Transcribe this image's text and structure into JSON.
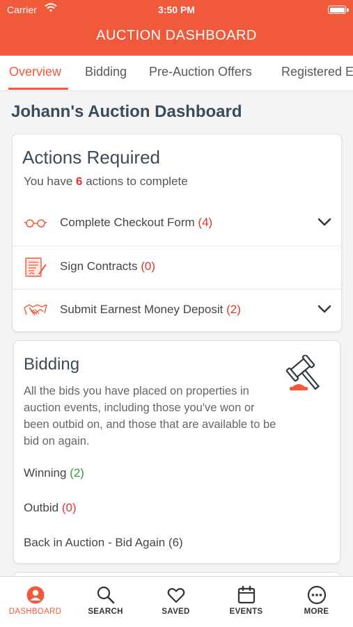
{
  "status": {
    "carrier": "Carrier",
    "time": "3:50 PM"
  },
  "header": {
    "title": "AUCTION DASHBOARD"
  },
  "tabs": [
    {
      "label": "Overview",
      "active": true
    },
    {
      "label": "Bidding"
    },
    {
      "label": "Pre-Auction Offers"
    },
    {
      "label": "Registered Events"
    }
  ],
  "page_title": "Johann's Auction Dashboard",
  "actions": {
    "title": "Actions Required",
    "sub_prefix": "You have",
    "count": "6",
    "sub_suffix": "actions to complete",
    "items": [
      {
        "icon": "glasses-icon",
        "label": "Complete Checkout Form",
        "count": "(4)",
        "expandable": true
      },
      {
        "icon": "contract-icon",
        "label": "Sign Contracts",
        "count": "(0)",
        "expandable": false
      },
      {
        "icon": "handshake-icon",
        "label": "Submit Earnest Money Deposit",
        "count": "(2)",
        "expandable": true
      }
    ]
  },
  "bidding": {
    "title": "Bidding",
    "description": "All the bids you have placed on properties in auction events, including those you've won or been outbid on, and those that are available to be bid on again.",
    "lines": [
      {
        "label": "Winning",
        "count": "(2)"
      },
      {
        "label": "Outbid",
        "count": "(0)"
      },
      {
        "label": "Back in Auction - Bid Again",
        "count": "(6)"
      }
    ]
  },
  "nav": [
    {
      "label": "DASHBOARD",
      "icon": "person-icon",
      "active": true
    },
    {
      "label": "SEARCH",
      "icon": "search-icon"
    },
    {
      "label": "SAVED",
      "icon": "heart-icon"
    },
    {
      "label": "EVENTS",
      "icon": "calendar-icon"
    },
    {
      "label": "MORE",
      "icon": "more-icon"
    }
  ],
  "colors": {
    "brand": "#f05a3b",
    "alert": "#e0342e",
    "success": "#2e9d3a"
  }
}
